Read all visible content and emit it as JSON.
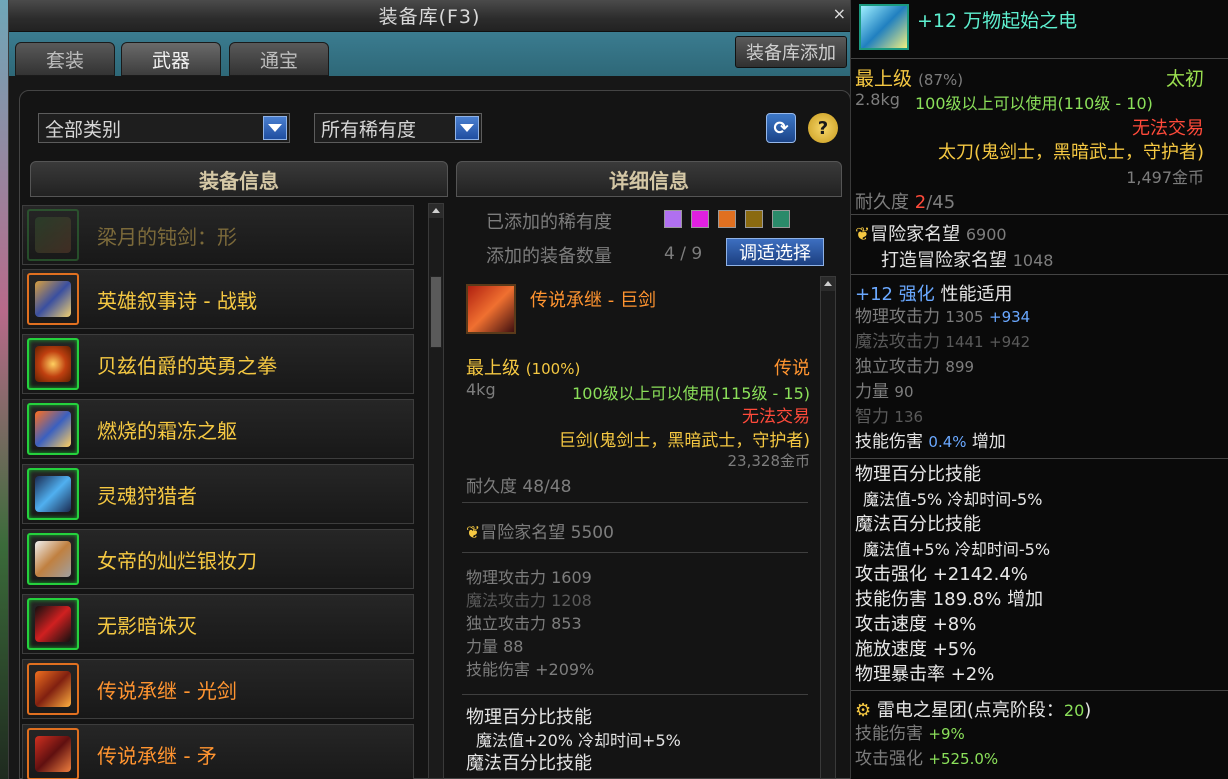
{
  "window": {
    "title": "装备库(F3)",
    "close": "×"
  },
  "tabs": [
    {
      "label": "套装"
    },
    {
      "label": "武器"
    },
    {
      "label": "通宝"
    }
  ],
  "add_button": "装备库添加",
  "filters": {
    "category": "全部类别",
    "rarity": "所有稀有度"
  },
  "panels": {
    "list_header": "装备信息",
    "detail_header": "详细信息"
  },
  "items": [
    {
      "name": "梁月的钝剑：形",
      "style": "dim"
    },
    {
      "name": "英雄叙事诗 - 战戟",
      "style": "gold"
    },
    {
      "name": "贝兹伯爵的英勇之拳",
      "style": "gold"
    },
    {
      "name": "燃烧的霜冻之躯",
      "style": "gold"
    },
    {
      "name": "灵魂狩猎者",
      "style": "gold"
    },
    {
      "name": "女帝的灿烂银妆刀",
      "style": "gold"
    },
    {
      "name": "无影暗诛灭",
      "style": "gold"
    },
    {
      "name": "传说承继 - 光剑",
      "style": "orange"
    },
    {
      "name": "传说承继 - 矛",
      "style": "orange"
    }
  ],
  "detail": {
    "rarity_label": "已添加的稀有度",
    "count_label": "添加的装备数量",
    "count_value": "4 / 9",
    "adjust_button": "调适选择",
    "item_name": "传说承继 - 巨剑",
    "grade": "最上级",
    "grade_pct": "(100%)",
    "rarity": "传说",
    "weight": "4kg",
    "level_req": "100级以上可以使用(115级 - 15)",
    "trade": "无法交易",
    "type": "巨剑(鬼剑士，黑暗武士，守护者)",
    "price": "23,328金币",
    "durability": "耐久度 48/48",
    "reputation": "冒险家名望",
    "reputation_value": "5500",
    "stats": [
      {
        "label": "物理攻击力",
        "value": "1609"
      },
      {
        "label": "魔法攻击力",
        "value": "1208"
      },
      {
        "label": "独立攻击力",
        "value": "853"
      },
      {
        "label": "力量",
        "value": "88"
      },
      {
        "label": "技能伤害",
        "value": "+209%"
      }
    ],
    "skill1": "物理百分比技能",
    "skill1_line": "魔法值+20% 冷却时间+5%",
    "skill2": "魔法百分比技能"
  },
  "tooltip": {
    "name": "+12 万物起始之电",
    "grade": "最上级",
    "grade_pct": "(87%)",
    "rarity": "太初",
    "weight": "2.8kg",
    "level_req": "100级以上可以使用(110级 - 10)",
    "trade": "无法交易",
    "type": "太刀(鬼剑士，黑暗武士，守护者)",
    "price": "1,497金币",
    "durability_label": "耐久度",
    "durability_cur": "2",
    "durability_max": "/45",
    "reputation": "冒险家名望",
    "reputation_value": "6900",
    "forge_rep": "打造冒险家名望",
    "forge_rep_value": "1048",
    "enhance": "+12 强化",
    "enhance_desc": "性能适用",
    "stats": [
      {
        "label": "物理攻击力",
        "value": "1305",
        "bonus": "+934"
      },
      {
        "label": "魔法攻击力",
        "value": "1441",
        "bonus": "+942"
      },
      {
        "label": "独立攻击力",
        "value": "899",
        "bonus": ""
      },
      {
        "label": "力量",
        "value": "90",
        "bonus": ""
      },
      {
        "label": "智力",
        "value": "136",
        "bonus": ""
      }
    ],
    "skill_dmg": "技能伤害",
    "skill_dmg_val": "0.4%",
    "skill_dmg_suffix": "增加",
    "opts": [
      "物理百分比技能",
      " 魔法值-5% 冷却时间-5%",
      "魔法百分比技能",
      " 魔法值+5% 冷却时间-5%",
      "攻击强化 +2142.4%",
      "技能伤害 189.8% 增加",
      "攻击速度 +8%",
      "施放速度 +5%",
      "物理暴击率 +2%"
    ],
    "set_name": "雷电之星团(点亮阶段：",
    "set_stage": "20",
    "set_close": ")",
    "set_stats": [
      {
        "label": "技能伤害",
        "value": "+9%"
      },
      {
        "label": "攻击强化",
        "value": "+525.0%"
      }
    ]
  }
}
